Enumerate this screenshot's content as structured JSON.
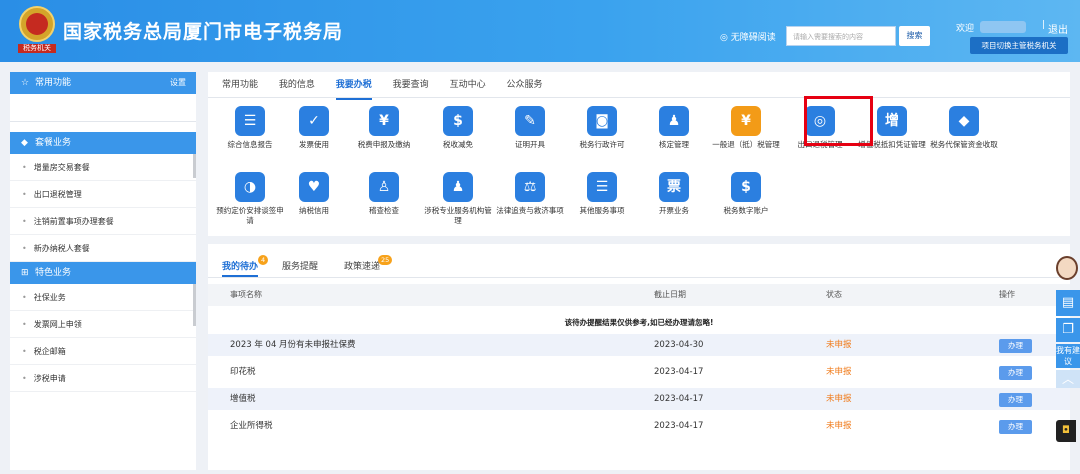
{
  "header": {
    "emblem_caption": "税务机关",
    "title": "国家税务总局厦门市电子税务局",
    "accessibility": "无障碍阅读",
    "search_placeholder": "请输入需要搜索的内容",
    "search_button": "搜索",
    "welcome": "欢迎",
    "separator": "|",
    "logout": "退出",
    "switch_org": "项目切换主管税务机关"
  },
  "sidebar": {
    "common": {
      "title": "常用功能",
      "settings": "设置"
    },
    "package": {
      "title": "套餐业务",
      "items": [
        "增量房交易套餐",
        "出口退税管理",
        "注销前置事项办理套餐",
        "新办纳税人套餐"
      ]
    },
    "special": {
      "title": "特色业务",
      "items": [
        "社保业务",
        "发票网上申领",
        "税企邮箱",
        "涉税申请"
      ]
    }
  },
  "main": {
    "tabs": [
      "常用功能",
      "我的信息",
      "我要办税",
      "我要查询",
      "互动中心",
      "公众服务"
    ],
    "active_tab": 2,
    "icons": [
      {
        "label": "综合信息报告",
        "icon": "report-icon",
        "color": "#2b7fe0",
        "glyph": "☰"
      },
      {
        "label": "发票使用",
        "icon": "invoice-icon",
        "color": "#2b7fe0",
        "glyph": "✓"
      },
      {
        "label": "税费申报及缴纳",
        "icon": "tax-declare-icon",
        "color": "#2b7fe0",
        "glyph": "¥"
      },
      {
        "label": "税收减免",
        "icon": "tax-relief-icon",
        "color": "#2b7fe0",
        "glyph": "$"
      },
      {
        "label": "证明开具",
        "icon": "certificate-icon",
        "color": "#2b7fe0",
        "glyph": "✎"
      },
      {
        "label": "税务行政许可",
        "icon": "permit-icon",
        "color": "#2b7fe0",
        "glyph": "◙"
      },
      {
        "label": "核定管理",
        "icon": "verify-manage-icon",
        "color": "#2b7fe0",
        "glyph": "♟"
      },
      {
        "label": "一般退（抵）税管理",
        "icon": "tax-refund-icon",
        "color": "#f39b17",
        "glyph": "¥"
      },
      {
        "label": "出口退税管理",
        "icon": "export-refund-icon",
        "color": "#2b7fe0",
        "glyph": "◎"
      },
      {
        "label": "增值税抵扣凭证管理",
        "icon": "vat-deduction-icon",
        "color": "#2b7fe0",
        "glyph": "增"
      },
      {
        "label": "税务代保管资金收取",
        "icon": "custody-fund-icon",
        "color": "#2b7fe0",
        "glyph": "◆"
      },
      {
        "label": "预约定价安排谈签申请",
        "icon": "pricing-icon",
        "color": "#2b7fe0",
        "glyph": "◑"
      },
      {
        "label": "纳税信用",
        "icon": "credit-icon",
        "color": "#2b7fe0",
        "glyph": "♥"
      },
      {
        "label": "稽查检查",
        "icon": "inspection-icon",
        "color": "#2b7fe0",
        "glyph": "♙"
      },
      {
        "label": "涉税专业服务机构管理",
        "icon": "agency-icon",
        "color": "#2b7fe0",
        "glyph": "♟"
      },
      {
        "label": "法律追责与救济事项",
        "icon": "law-icon",
        "color": "#2b7fe0",
        "glyph": "⚖"
      },
      {
        "label": "其他服务事项",
        "icon": "other-service-icon",
        "color": "#2b7fe0",
        "glyph": "☰"
      },
      {
        "label": "开票业务",
        "icon": "issue-invoice-icon",
        "color": "#2b7fe0",
        "glyph": "票"
      },
      {
        "label": "税务数字账户",
        "icon": "digital-account-icon",
        "color": "#2b7fe0",
        "glyph": "$"
      }
    ]
  },
  "todo": {
    "tabs": [
      {
        "label": "我的待办",
        "badge": "4"
      },
      {
        "label": "服务提醒",
        "badge": ""
      },
      {
        "label": "政策速递",
        "badge": "25"
      }
    ],
    "columns": [
      "事项名称",
      "截止日期",
      "状态",
      "操作"
    ],
    "note": "该待办提醒结果仅供参考,如已经办理请忽略!",
    "rows": [
      {
        "name": "2023 年 04 月份有未申报社保费",
        "date": "2023-04-30",
        "status": "未申报",
        "action": "办理"
      },
      {
        "name": "印花税",
        "date": "2023-04-17",
        "status": "未申报",
        "action": "办理"
      },
      {
        "name": "增值税",
        "date": "2023-04-17",
        "status": "未申报",
        "action": "办理"
      },
      {
        "name": "企业所得税",
        "date": "2023-04-17",
        "status": "未申报",
        "action": "办理"
      }
    ]
  },
  "float": {
    "suggest": "我有建议"
  }
}
